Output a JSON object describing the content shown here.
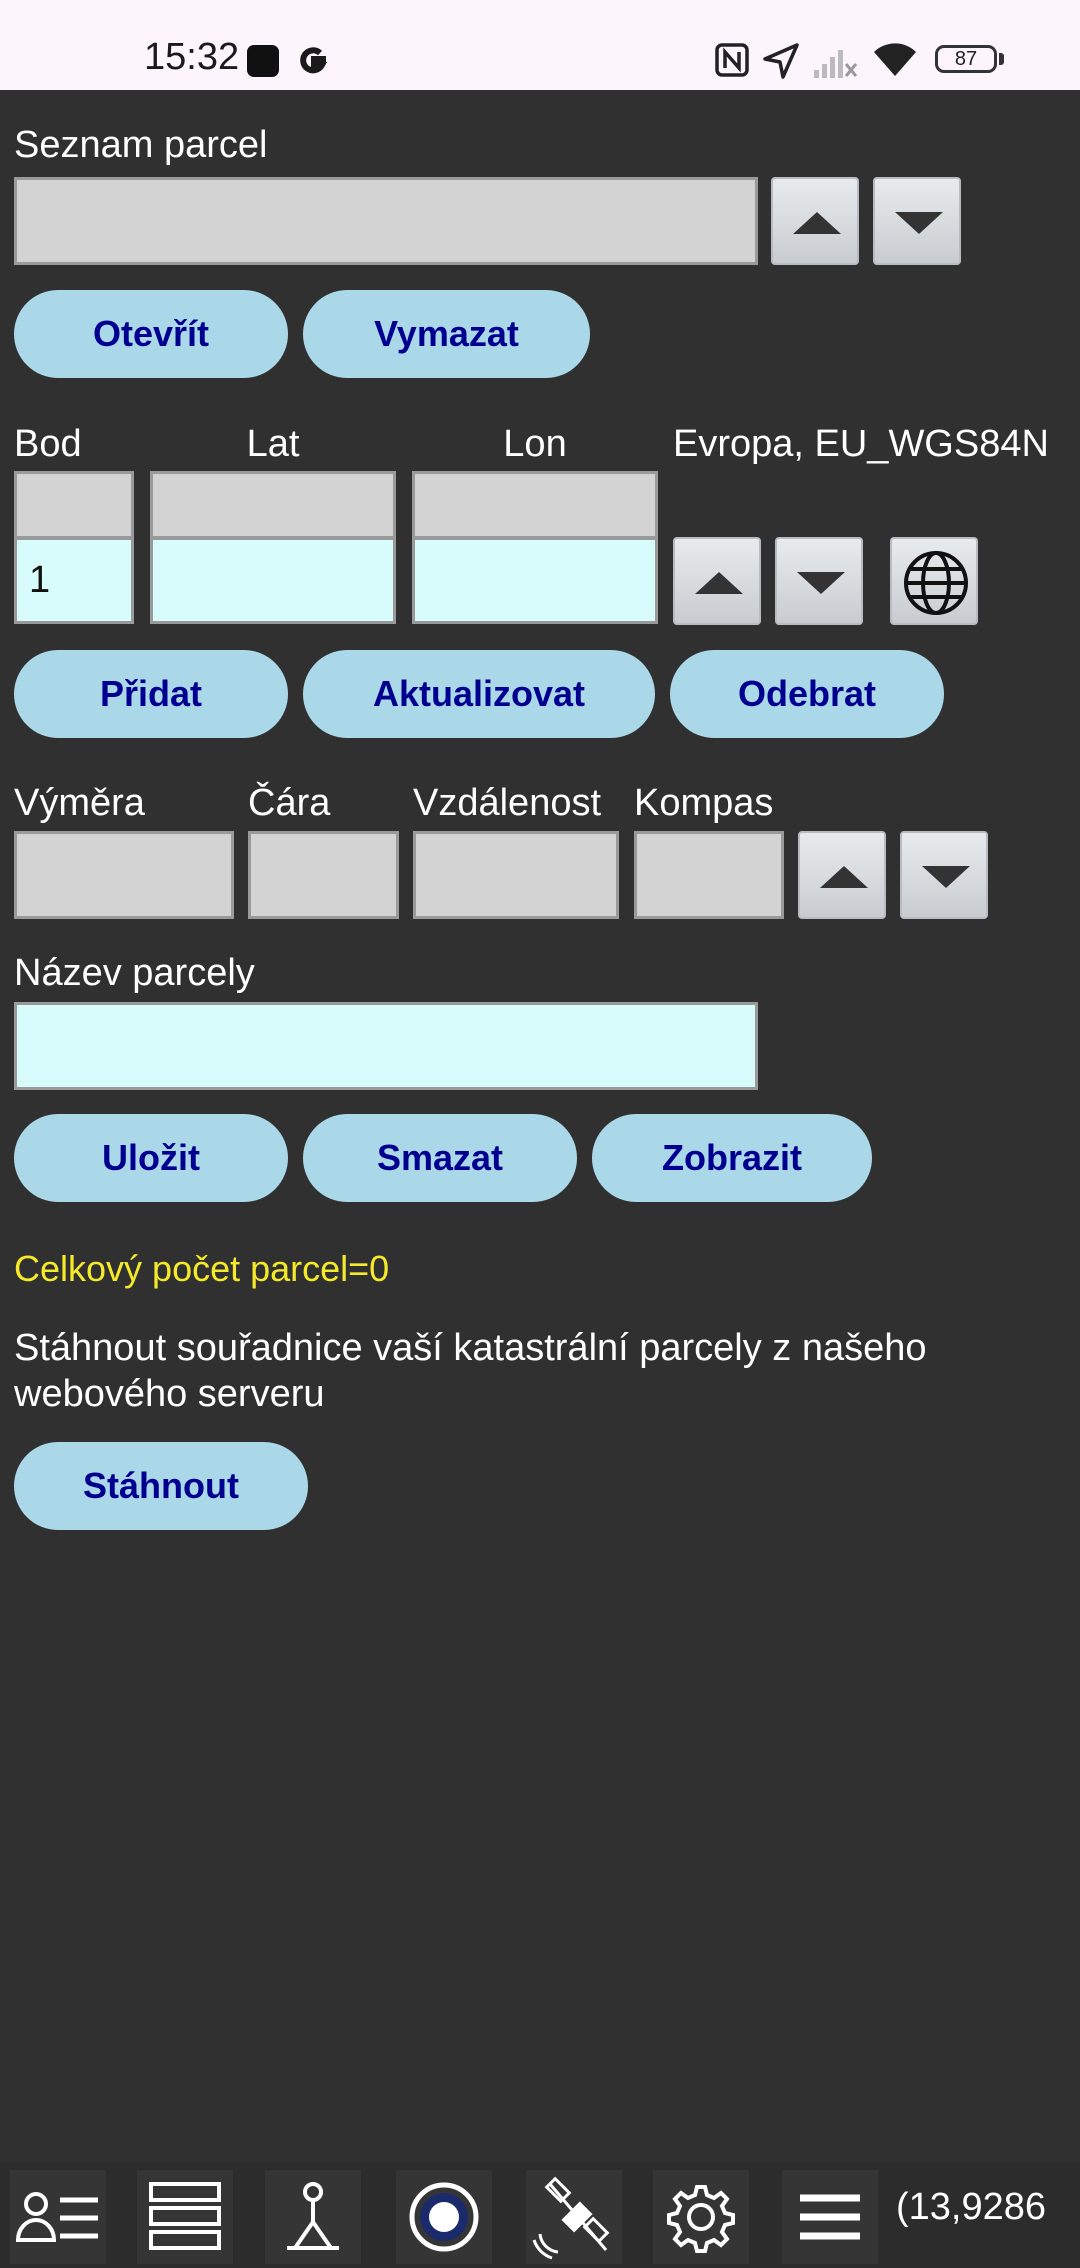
{
  "status_bar": {
    "time": "15:32",
    "battery_level": "87",
    "icons": [
      "square-notification-icon",
      "google-icon",
      "nfc-icon",
      "location-arrow-icon",
      "signal-off-icon",
      "wifi-icon",
      "battery-icon"
    ]
  },
  "parcel_list": {
    "label": "Seznam parcel",
    "value": "",
    "open_label": "Otevřít",
    "clear_label": "Vymazat"
  },
  "points": {
    "bod_label": "Bod",
    "lat_label": "Lat",
    "lon_label": "Lon",
    "crs_label": "Evropa, EU_WGS84N",
    "bod_value": "1",
    "lat_value": "",
    "lon_value": "",
    "add_label": "Přidat",
    "update_label": "Aktualizovat",
    "remove_label": "Odebrat"
  },
  "measure": {
    "area_label": "Výměra",
    "line_label": "Čára",
    "distance_label": "Vzdálenost",
    "compass_label": "Kompas"
  },
  "parcel_name": {
    "label": "Název parcely",
    "value": "",
    "save_label": "Uložit",
    "delete_label": "Smazat",
    "show_label": "Zobrazit"
  },
  "total_text": "Celkový počet parcel=0",
  "download": {
    "description": "Stáhnout souřadnice vaší katastrální parcely z našeho webového serveru",
    "button_label": "Stáhnout"
  },
  "bottom_nav": {
    "coordinates": "(13,9286",
    "icons": [
      "user-list-icon",
      "layers-list-icon",
      "survey-point-icon",
      "record-icon",
      "satellite-icon",
      "settings-icon",
      "menu-icon"
    ]
  },
  "colors": {
    "background": "#303030",
    "pill_button": "#abd8e9",
    "pill_text": "#000090",
    "input_cyan": "#d8fcfc",
    "input_gray": "#d3d3d3",
    "highlight_text": "#f5ea2a"
  }
}
